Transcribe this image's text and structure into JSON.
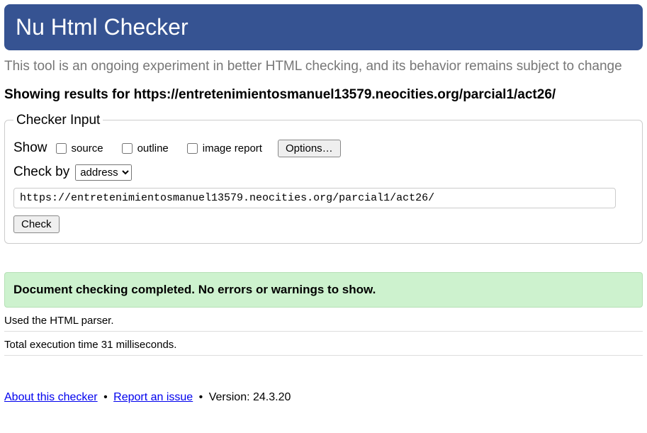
{
  "header": {
    "title": "Nu Html Checker"
  },
  "tagline": "This tool is an ongoing experiment in better HTML checking, and its behavior remains subject to change",
  "results_for": "Showing results for https://entretenimientosmanuel13579.neocities.org/parcial1/act26/",
  "checker_input": {
    "legend": "Checker Input",
    "show_label": "Show",
    "source_label": "source",
    "outline_label": "outline",
    "image_report_label": "image report",
    "options_button": "Options…",
    "check_by_label": "Check by",
    "check_by_options": [
      "address"
    ],
    "check_by_selected": "address",
    "url_value": "https://entretenimientosmanuel13579.neocities.org/parcial1/act26/",
    "check_button": "Check"
  },
  "success_message": "Document checking completed. No errors or warnings to show.",
  "parser_info": "Used the HTML parser.",
  "timing_info": "Total execution time 31 milliseconds.",
  "footer": {
    "about_link": "About this checker",
    "report_link": "Report an issue",
    "version_label": "Version: 24.3.20",
    "sep": "•"
  }
}
